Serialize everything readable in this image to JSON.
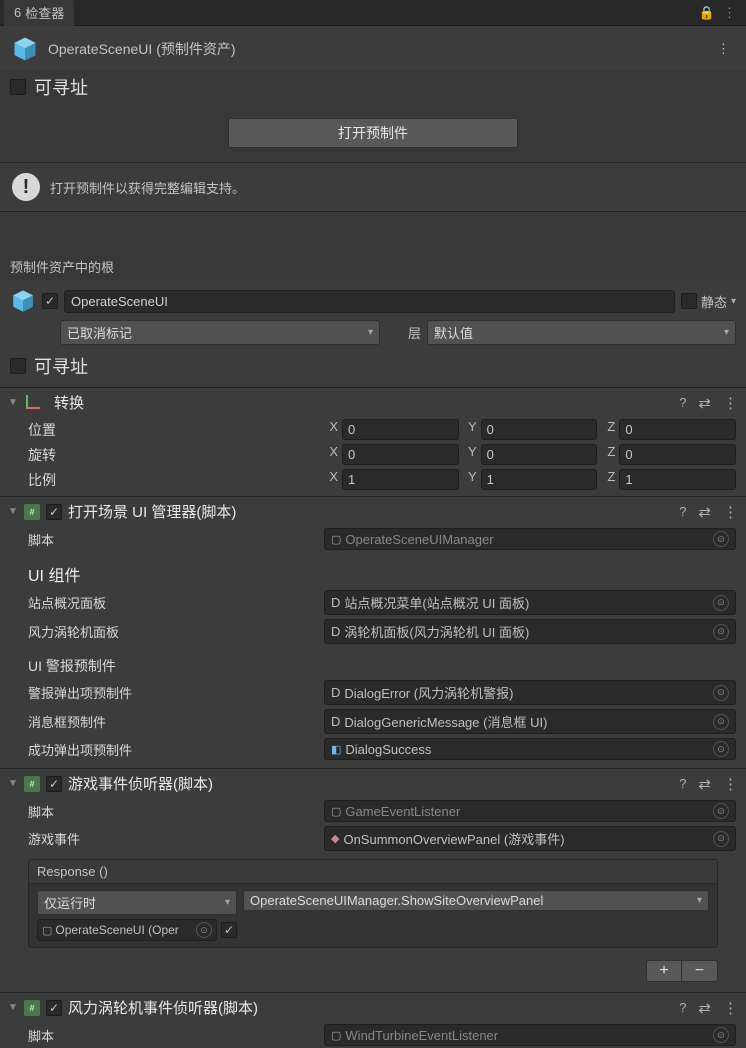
{
  "tabBar": {
    "title": "检查器",
    "tabIcon": "6"
  },
  "header": {
    "assetName": "OperateSceneUI",
    "assetKind": "(预制件资产)",
    "addressableLabel": "可寻址",
    "openPrefabBtn": "打开预制件",
    "noticeText": "打开预制件以获得完整编辑支持。"
  },
  "rootLabel": "预制件资产中的根",
  "gameObject": {
    "name": "OperateSceneUI",
    "staticLabel": "静态",
    "tagValue": "已取消标记",
    "layerLabel": "层",
    "layerValue": "默认值",
    "addressableLabel": "可寻址"
  },
  "transform": {
    "title": "转换",
    "posLabel": "位置",
    "rotLabel": "旋转",
    "scaleLabel": "比例",
    "pos": {
      "x": "0",
      "y": "0",
      "z": "0"
    },
    "rot": {
      "x": "0",
      "y": "0",
      "z": "0"
    },
    "scale": {
      "x": "1",
      "y": "1",
      "z": "1"
    }
  },
  "manager": {
    "title": "打开场景 UI 管理器(脚本)",
    "scriptLabel": "脚本",
    "scriptValue": "OperateSceneUIManager",
    "uiGroupLabel": "UI 组件",
    "siteOverviewPanelLabel": "站点概况面板",
    "siteOverviewPanelValue": "站点概况菜单(站点概况 UI 面板)",
    "windTurbinePanelLabel": "风力涡轮机面板",
    "windTurbinePanelValue": "涡轮机面板(风力涡轮机 UI 面板)",
    "alertPrefabsLabel": "UI 警报预制件",
    "alertPopupLabel": "警报弹出项预制件",
    "alertPopupValue": "DialogError (风力涡轮机警报)",
    "msgBoxPrefabLabel": "消息框预制件",
    "msgBoxPrefabValue": "DialogGenericMessage (消息框 UI)",
    "successPopupLabel": "成功弹出项预制件",
    "successPopupValue": "DialogSuccess"
  },
  "listener1": {
    "title": "游戏事件侦听器(脚本)",
    "scriptLabel": "脚本",
    "scriptValue": "GameEventListener",
    "gameEventLabel": "游戏事件",
    "gameEventValue": "OnSummonOverviewPanel (游戏事件)",
    "responseLabel": "Response ()",
    "runtimeMode": "仅运行时",
    "method": "OperateSceneUIManager.ShowSiteOverviewPanel",
    "targetObj": "OperateSceneUI (Oper"
  },
  "listener2": {
    "title": "风力涡轮机事件侦听器(脚本)",
    "scriptLabel": "脚本",
    "scriptValue": "WindTurbineEventListener"
  },
  "glyphs": {
    "plus": "+",
    "minus": "−",
    "arrowDown": "▾",
    "tri": "▼",
    "help": "?",
    "preset": "⇄",
    "dots": "⋮",
    "D": "D"
  }
}
